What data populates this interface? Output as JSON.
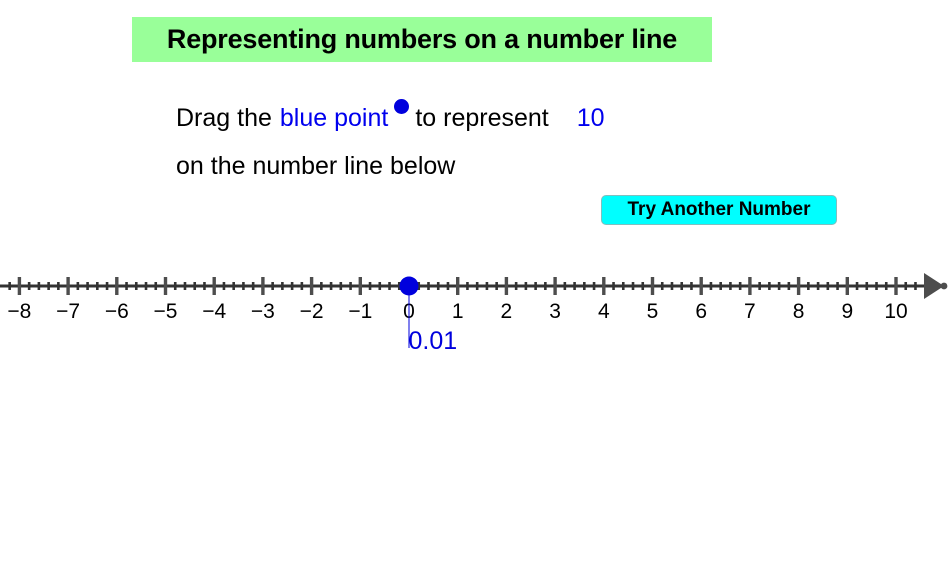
{
  "title": {
    "text": "Representing numbers on a number line",
    "background_color": "#99ff99"
  },
  "instruction": {
    "line1_prefix": "Drag the",
    "line1_highlight": "blue point",
    "line1_dot_icon": "blue-dot-icon",
    "line1_middle": "to represent",
    "line1_target_value": "10",
    "line2": "on the number line below",
    "highlight_color": "#0000ee"
  },
  "controls": {
    "try_another_label": "Try Another Number",
    "try_another_color": "#00ffff"
  },
  "chart_data": {
    "type": "number-line",
    "title": "Representing numbers on a number line",
    "xlabel": "",
    "ylabel": "",
    "axis_color": "#333333",
    "xlim": [
      -8.45,
      10.45
    ],
    "tick_labels": [
      "−8",
      "−7",
      "−6",
      "−5",
      "−4",
      "−3",
      "−2",
      "−1",
      "0",
      "1",
      "2",
      "3",
      "4",
      "5",
      "6",
      "7",
      "8",
      "9",
      "10"
    ],
    "tick_values": [
      -8,
      -7,
      -6,
      -5,
      -4,
      -3,
      -2,
      -1,
      0,
      1,
      2,
      3,
      4,
      5,
      6,
      7,
      8,
      9,
      10
    ],
    "minor_tick_step": 0.2,
    "grid": false,
    "legend": false,
    "right_arrow": true,
    "point": {
      "name": "blue-point",
      "value": 0.01,
      "value_label": "0.01",
      "color": "#0000dd"
    },
    "target_value": 10
  }
}
